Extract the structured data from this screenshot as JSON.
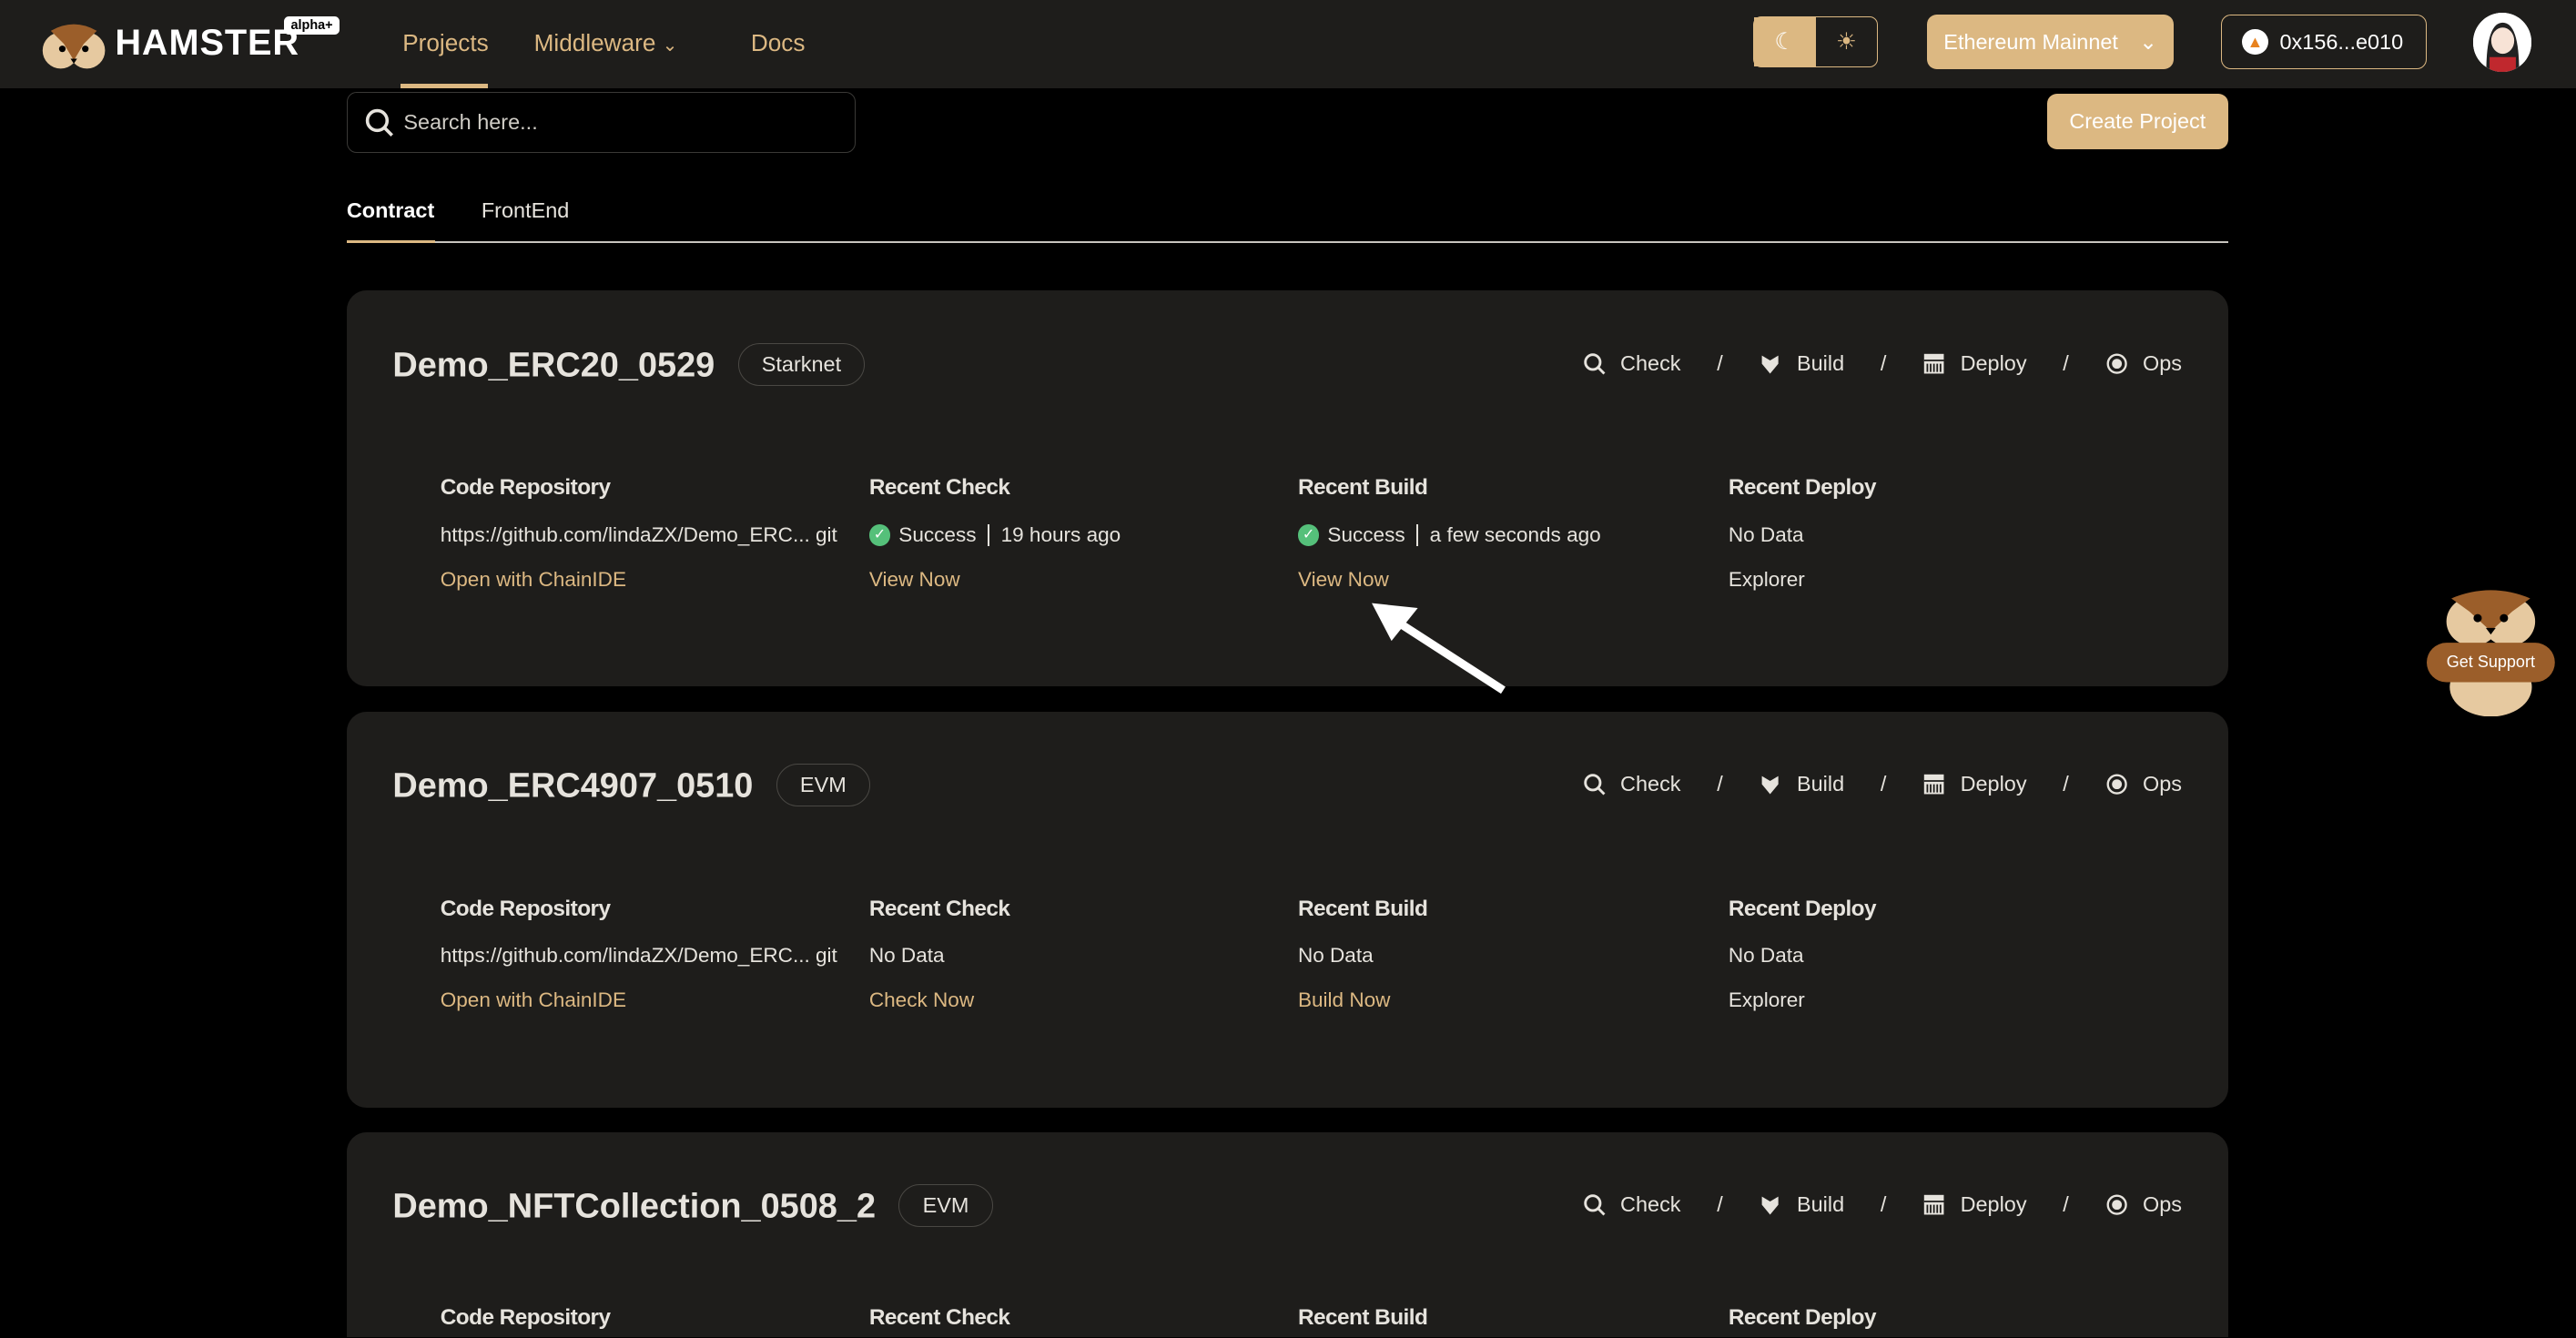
{
  "header": {
    "brand": "HAMSTER",
    "brand_badge": "alpha+",
    "nav": [
      "Projects",
      "Middleware",
      "Docs"
    ],
    "active_nav": "Projects",
    "network": "Ethereum Mainnet",
    "wallet": "0x156...e010",
    "accent": "#dcb882"
  },
  "toolbar": {
    "search_placeholder": "Search here...",
    "create_label": "Create Project"
  },
  "tabs": [
    "Contract",
    "FrontEnd"
  ],
  "active_tab": "Contract",
  "actions": [
    "Check",
    "Build",
    "Deploy",
    "Ops"
  ],
  "column_headers": [
    "Code Repository",
    "Recent Check",
    "Recent Build",
    "Recent Deploy"
  ],
  "projects": [
    {
      "name": "Demo_ERC20_0529",
      "chain": "Starknet",
      "repo": "https://github.com/lindaZX/Demo_ERC... git",
      "repo_link": "Open with ChainIDE",
      "check_status": "Success",
      "check_time": "19 hours ago",
      "check_link": "View Now",
      "build_status": "Success",
      "build_time": "a few seconds ago",
      "build_link": "View Now",
      "deploy_status": "No Data",
      "deploy_link": "Explorer"
    },
    {
      "name": "Demo_ERC4907_0510",
      "chain": "EVM",
      "repo": "https://github.com/lindaZX/Demo_ERC... git",
      "repo_link": "Open with ChainIDE",
      "check_status": "No Data",
      "check_link": "Check Now",
      "build_status": "No Data",
      "build_link": "Build Now",
      "deploy_status": "No Data",
      "deploy_link": "Explorer"
    },
    {
      "name": "Demo_NFTCollection_0508_2",
      "chain": "EVM"
    }
  ],
  "support": {
    "label": "Get Support"
  },
  "status_colors": {
    "success": "#55c07a"
  }
}
